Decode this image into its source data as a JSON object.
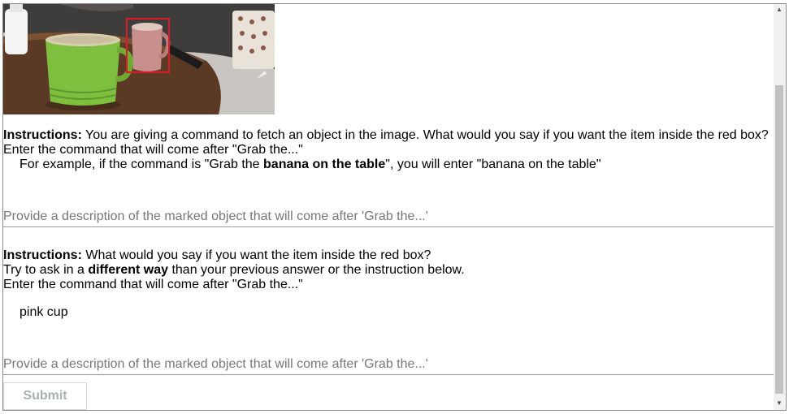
{
  "image": {
    "alt": "Table with a green mug and a pink cup inside a red box"
  },
  "q1": {
    "label": "Instructions:",
    "text": " You are giving a command to fetch an object in the image. What would you say if you want the item inside the red box?",
    "line2": "Enter the command that will come after \"Grab the...\"",
    "ex_pre": "For example, if the command is \"Grab the ",
    "ex_bold": "banana on the table",
    "ex_post": "\", you will enter \"banana on the table\"",
    "placeholder": "Provide a description of the marked object that will come after 'Grab the...'"
  },
  "q2": {
    "label": "Instructions:",
    "text": " What would you say if you want the item inside the red box?",
    "line2_pre": "Try to ask in a ",
    "line2_bold": "different way",
    "line2_post": " than your previous answer or the instruction below.",
    "line3": "Enter the command that will come after \"Grab the...\"",
    "prior": "pink cup",
    "placeholder": "Provide a description of the marked object that will come after 'Grab the...'"
  },
  "submit_label": "Submit"
}
